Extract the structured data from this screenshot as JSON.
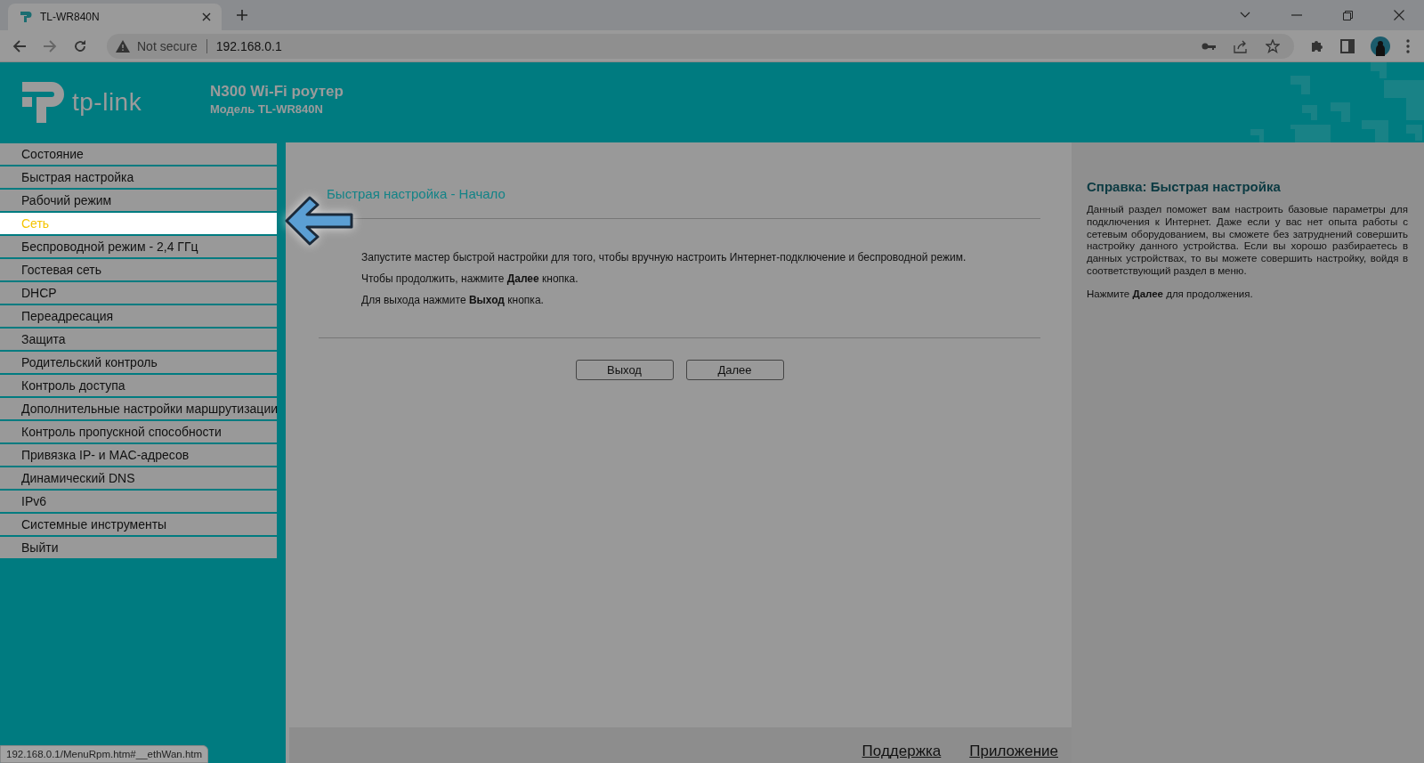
{
  "browser": {
    "tab_title": "TL-WR840N",
    "security": "Not secure",
    "url": "192.168.0.1"
  },
  "header": {
    "logo": "tp-link",
    "title": "N300 Wi-Fi роутер",
    "subtitle": "Модель TL-WR840N"
  },
  "sidebar": {
    "items": [
      {
        "label": "Состояние",
        "selected": false
      },
      {
        "label": "Быстрая настройка",
        "selected": false
      },
      {
        "label": "Рабочий режим",
        "selected": false
      },
      {
        "label": "Сеть",
        "selected": true
      },
      {
        "label": "Беспроводной режим - 2,4 ГГц",
        "selected": false
      },
      {
        "label": "Гостевая сеть",
        "selected": false
      },
      {
        "label": "DHCP",
        "selected": false
      },
      {
        "label": "Переадресация",
        "selected": false
      },
      {
        "label": "Защита",
        "selected": false
      },
      {
        "label": "Родительский контроль",
        "selected": false
      },
      {
        "label": "Контроль доступа",
        "selected": false
      },
      {
        "label": "Дополнительные настройки маршрутизации",
        "selected": false
      },
      {
        "label": "Контроль пропускной способности",
        "selected": false
      },
      {
        "label": "Привязка IP- и MAC-адресов",
        "selected": false
      },
      {
        "label": "Динамический DNS",
        "selected": false
      },
      {
        "label": "IPv6",
        "selected": false
      },
      {
        "label": "Системные инструменты",
        "selected": false
      },
      {
        "label": "Выйти",
        "selected": false
      }
    ]
  },
  "content": {
    "title": "Быстрая настройка - Начало",
    "paragraphs": [
      "Запустите мастер быстрой настройки для того, чтобы вручную настроить Интернет-подключение и беспроводной режим.",
      "Чтобы продолжить, нажмите **Далее** кнопка.",
      "Для выхода нажмите **Выход** кнопка."
    ],
    "buttons": [
      "Выход",
      "Далее"
    ]
  },
  "help": {
    "title": "Справка: Быстрая настройка",
    "paragraphs": [
      "Данный раздел поможет вам настроить базовые параметры для подключения к Интернет. Даже если у вас нет опыта работы с сетевым оборудованием, вы сможете без затруднений совершить настройку данного устройства. Если вы хорошо разбираетесь в данных устройствах, то вы можете совершить настройку, войдя в соответствующий раздел в меню.",
      "Нажмите **Далее** для продолжения."
    ]
  },
  "footer": {
    "links": [
      "Поддержка",
      "Приложение"
    ]
  },
  "status_url": "192.168.0.1/MenuRpm.htm#__ethWan.htm"
}
